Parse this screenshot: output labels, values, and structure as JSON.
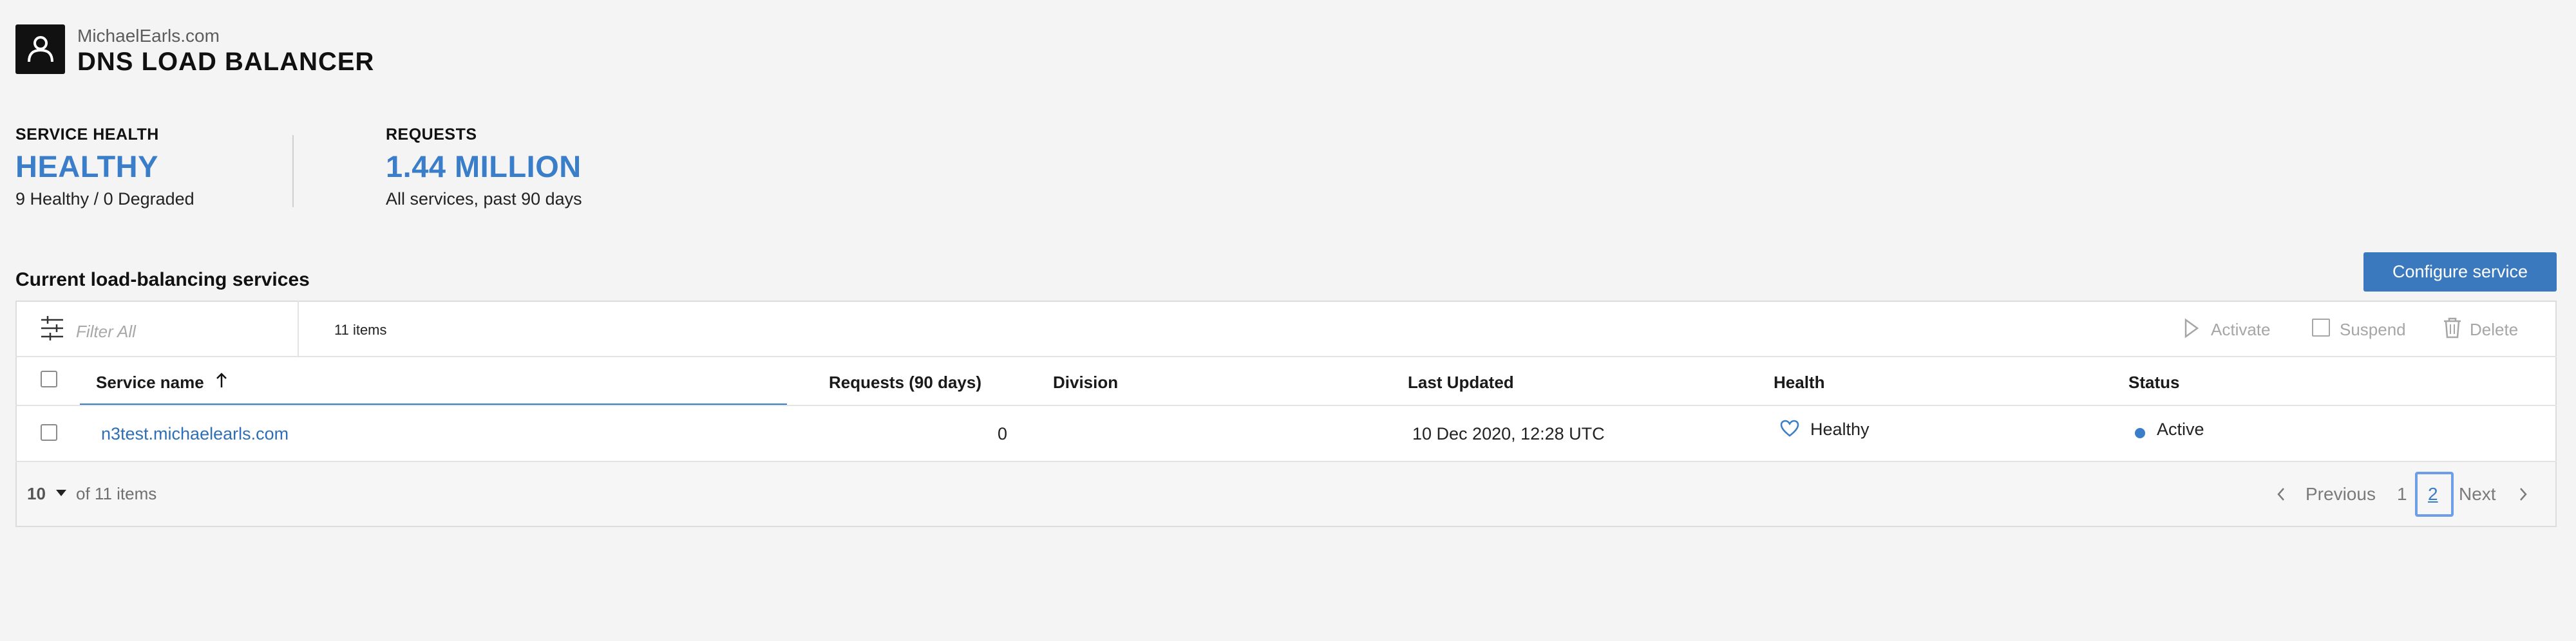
{
  "header": {
    "org_name": "MichaelEarls.com",
    "app_title": "DNS LOAD BALANCER",
    "logo_icon": "user-icon"
  },
  "summary": {
    "health": {
      "label": "SERVICE HEALTH",
      "value": "HEALTHY",
      "sub": "9 Healthy / 0 Degraded"
    },
    "requests": {
      "label": "REQUESTS",
      "value": "1.44 MILLION",
      "sub": "All services, past 90 days"
    },
    "accent_color": "#3a7dc9"
  },
  "section": {
    "title": "Current load-balancing services",
    "configure_label": "Configure service"
  },
  "toolbar": {
    "filter_placeholder": "Filter All",
    "items_count": "11 items",
    "activate_label": "Activate",
    "suspend_label": "Suspend",
    "delete_label": "Delete"
  },
  "table": {
    "columns": [
      "Service name",
      "Requests (90 days)",
      "Division",
      "Last Updated",
      "Health",
      "Status"
    ],
    "sort_column": "Service name",
    "sort_direction": "ascending",
    "rows": [
      {
        "service": "n3test.michaelearls.com",
        "requests": "0",
        "division": "",
        "last_updated": "10 Dec 2020, 12:28 UTC",
        "health": "Healthy",
        "status": "Active"
      }
    ]
  },
  "footer": {
    "page_size": "10",
    "of_items": "of 11 items",
    "previous_label": "Previous",
    "pages": [
      "1",
      "2"
    ],
    "current_page": "2",
    "next_label": "Next"
  }
}
